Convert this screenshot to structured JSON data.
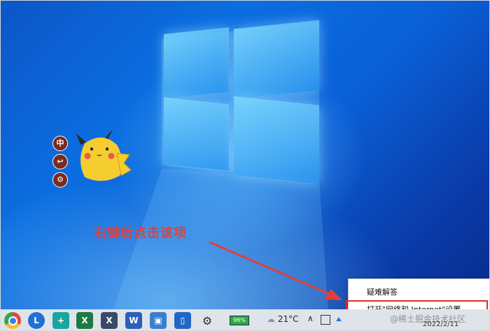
{
  "desktop": {
    "annotation_text": "右键后点击该项",
    "side_icons": [
      "中",
      "↩",
      "⚙"
    ]
  },
  "context_menu": {
    "items": [
      {
        "label": "疑难解答"
      },
      {
        "label": "打开\"网络和 Internet\"设置"
      }
    ]
  },
  "taskbar": {
    "apps": [
      {
        "name": "chrome-icon",
        "color": "#e8453c",
        "glyph": ""
      },
      {
        "name": "l-app-icon",
        "color": "#1f6fd6",
        "glyph": "L"
      },
      {
        "name": "plus-app-icon",
        "color": "#1aa5a0",
        "glyph": "+"
      },
      {
        "name": "excel-icon",
        "color": "#1e7a44",
        "glyph": "X"
      },
      {
        "name": "x-tool-icon",
        "color": "#3a4a66",
        "glyph": "X"
      },
      {
        "name": "word-icon",
        "color": "#2b5fb8",
        "glyph": "W"
      },
      {
        "name": "screen-capture-icon",
        "color": "#3b7fd0",
        "glyph": "▣"
      },
      {
        "name": "phone-link-icon",
        "color": "#2166c4",
        "glyph": "▯"
      },
      {
        "name": "gear-icon",
        "color": "#333333",
        "glyph": "⚙"
      }
    ],
    "battery_text": "96%",
    "temperature": "21°C",
    "tray_chevron": "∧",
    "date_text": "2022/2/11"
  },
  "watermark": "@稀土掘金技术社区",
  "colors": {
    "annotation": "#e0403a",
    "highlight_border": "#e12b2b",
    "taskbar_bg": "#dfe4ea"
  }
}
